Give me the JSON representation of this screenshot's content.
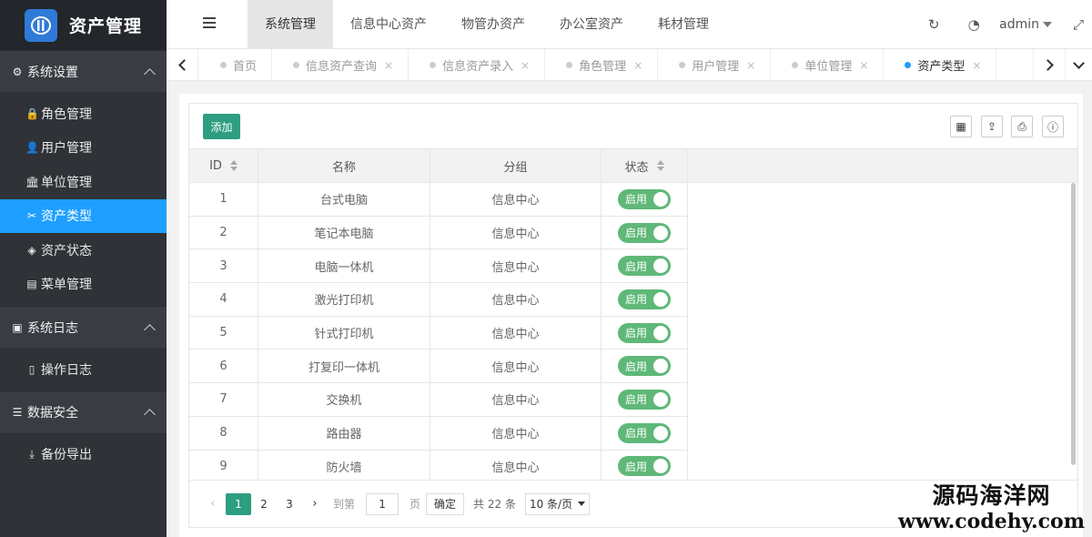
{
  "app": {
    "title": "资产管理"
  },
  "sidebar": {
    "groups": [
      {
        "label": "系统设置",
        "items": [
          "角色管理",
          "用户管理",
          "单位管理",
          "资产类型",
          "资产状态",
          "菜单管理"
        ]
      },
      {
        "label": "系统日志",
        "items": [
          "操作日志"
        ]
      },
      {
        "label": "数据安全",
        "items": [
          "备份导出"
        ]
      }
    ],
    "active_item": "资产类型"
  },
  "topnav": {
    "tabs": [
      "系统管理",
      "信息中心资产",
      "物管办资产",
      "办公室资产",
      "耗材管理"
    ],
    "active": "系统管理",
    "user": "admin"
  },
  "page_tabs": {
    "tabs": [
      "首页",
      "信息资产查询",
      "信息资产录入",
      "角色管理",
      "用户管理",
      "单位管理",
      "资产类型"
    ],
    "close_glyph": "×",
    "active": "资产类型"
  },
  "toolbar": {
    "add_label": "添加"
  },
  "table": {
    "columns": [
      "ID",
      "名称",
      "分组",
      "状态"
    ],
    "rows": [
      {
        "id": "1",
        "name": "台式电脑",
        "group": "信息中心",
        "status": "启用"
      },
      {
        "id": "2",
        "name": "笔记本电脑",
        "group": "信息中心",
        "status": "启用"
      },
      {
        "id": "3",
        "name": "电脑一体机",
        "group": "信息中心",
        "status": "启用"
      },
      {
        "id": "4",
        "name": "激光打印机",
        "group": "信息中心",
        "status": "启用"
      },
      {
        "id": "5",
        "name": "针式打印机",
        "group": "信息中心",
        "status": "启用"
      },
      {
        "id": "6",
        "name": "打复印一体机",
        "group": "信息中心",
        "status": "启用"
      },
      {
        "id": "7",
        "name": "交换机",
        "group": "信息中心",
        "status": "启用"
      },
      {
        "id": "8",
        "name": "路由器",
        "group": "信息中心",
        "status": "启用"
      },
      {
        "id": "9",
        "name": "防火墙",
        "group": "信息中心",
        "status": "启用"
      }
    ]
  },
  "pager": {
    "pages": [
      "1",
      "2",
      "3"
    ],
    "current": "1",
    "goto_label": "到第",
    "goto_value": "1",
    "page_suffix": "页",
    "confirm_label": "确定",
    "total_label": "共 22 条",
    "page_size": "10 条/页"
  },
  "watermark": {
    "line1": "源码海洋网",
    "line2": "www.codehy.com"
  },
  "colors": {
    "sidebar": "#2f3237",
    "active_nav": "#1e9fff",
    "primary": "#2d9e7f",
    "switch_on": "#5fb878"
  }
}
